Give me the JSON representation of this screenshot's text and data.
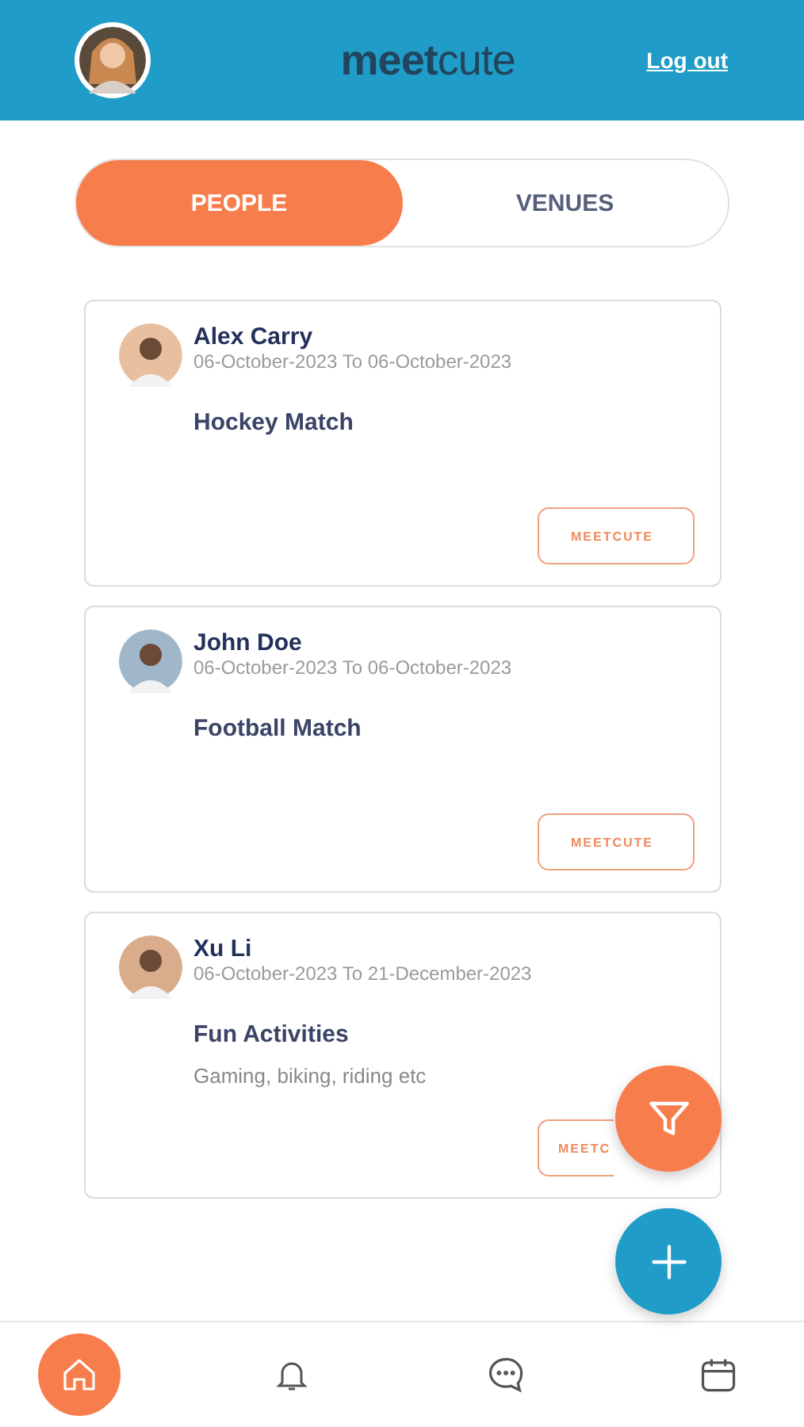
{
  "header": {
    "logo": "**meet**cute",
    "logout": "Log out"
  },
  "tabs": [
    {
      "label": "PEOPLE",
      "selected": true
    },
    {
      "label": "VENUES",
      "selected": false
    }
  ],
  "cards": [
    {
      "name": "Alex Carry",
      "dates": "06-October-2023 To 06-October-2023",
      "title": "Hockey Match",
      "button": "MEETCUTE"
    },
    {
      "name": "John Doe",
      "dates": "06-October-2023 To 06-October-2023",
      "title": "Football Match",
      "button": "MEETCUTE"
    },
    {
      "name": "Xu Li",
      "dates": "06-October-2023 To 21-December-2023",
      "title": "Fun Activities",
      "description": "Gaming, biking, riding etc",
      "button": "MEETC",
      "button_partly_hidden": true
    }
  ],
  "nav": [
    {
      "kind": "home",
      "selected": true
    },
    {
      "kind": "bell",
      "selected": false
    },
    {
      "kind": "chat",
      "selected": false
    },
    {
      "kind": "calendar",
      "selected": false
    }
  ]
}
